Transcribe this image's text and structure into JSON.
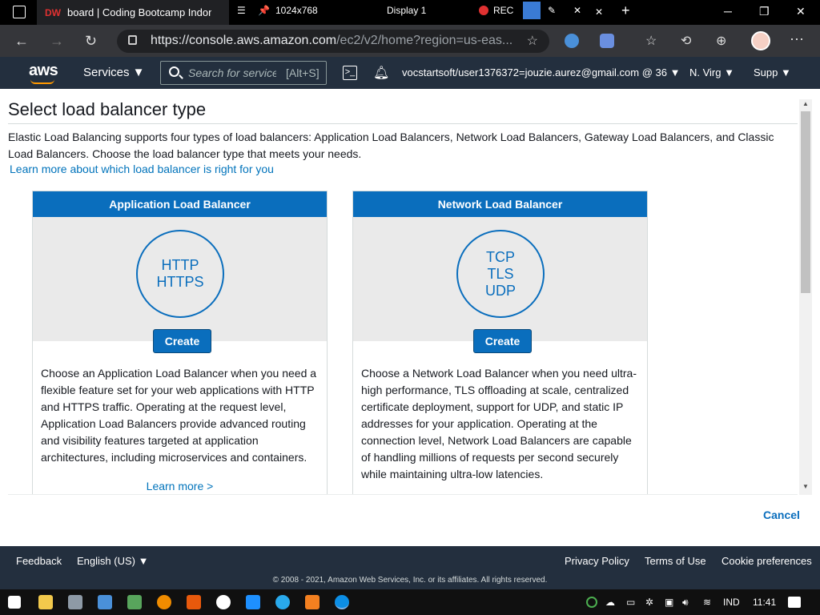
{
  "browser": {
    "tab_title": "board | Coding Bootcamp Indon",
    "tab_favicon": "DW",
    "share_resolution": "1024x768",
    "share_display": "Display 1",
    "share_rec": "REC",
    "url_main": "https://console.aws.amazon.com",
    "url_rest": "/ec2/v2/home?region=us-eas..."
  },
  "aws_nav": {
    "logo": "aws",
    "services": "Services ▼",
    "search_placeholder": "Search for service",
    "search_shortcut": "[Alt+S]",
    "account": "vocstartsoft/user1376372=jouzie.aurez@gmail.com @ 36 ▼",
    "region": "N. Virg ▼",
    "support": "Supp ▼"
  },
  "page": {
    "title": "Select load balancer type",
    "intro": "Elastic Load Balancing supports four types of load balancers: Application Load Balancers, Network Load Balancers, Gateway Load Balancers, and Classic Load Balancers. Choose the load balancer type that meets your needs.",
    "learn_link": "Learn more about which load balancer is right for you",
    "cancel": "Cancel"
  },
  "cards": [
    {
      "title": "Application Load Balancer",
      "protocols": [
        "HTTP",
        "HTTPS"
      ],
      "create": "Create",
      "description": "Choose an Application Load Balancer when you need a flexible feature set for your web applications with HTTP and HTTPS traffic. Operating at the request level, Application Load Balancers provide advanced routing and visibility features targeted at application architectures, including microservices and containers.",
      "learn_more": "Learn more >"
    },
    {
      "title": "Network Load Balancer",
      "protocols": [
        "TCP",
        "TLS",
        "UDP"
      ],
      "create": "Create",
      "description": "Choose a Network Load Balancer when you need ultra-high performance, TLS offloading at scale, centralized certificate deployment, support for UDP, and static IP addresses for your application. Operating at the connection level, Network Load Balancers are capable of handling millions of requests per second securely while maintaining ultra-low latencies."
    }
  ],
  "footer": {
    "feedback": "Feedback",
    "language": "English (US) ▼",
    "privacy": "Privacy Policy",
    "terms": "Terms of Use",
    "cookies": "Cookie preferences",
    "copyright": "© 2008 - 2021, Amazon Web Services, Inc. or its affiliates. All rights reserved."
  },
  "taskbar": {
    "lang": "IND",
    "time": "11:41"
  },
  "colors": {
    "aws_dark": "#232f3e",
    "card_header": "#0a6ebd",
    "link": "#0073bb",
    "aws_orange": "#ff9900"
  }
}
